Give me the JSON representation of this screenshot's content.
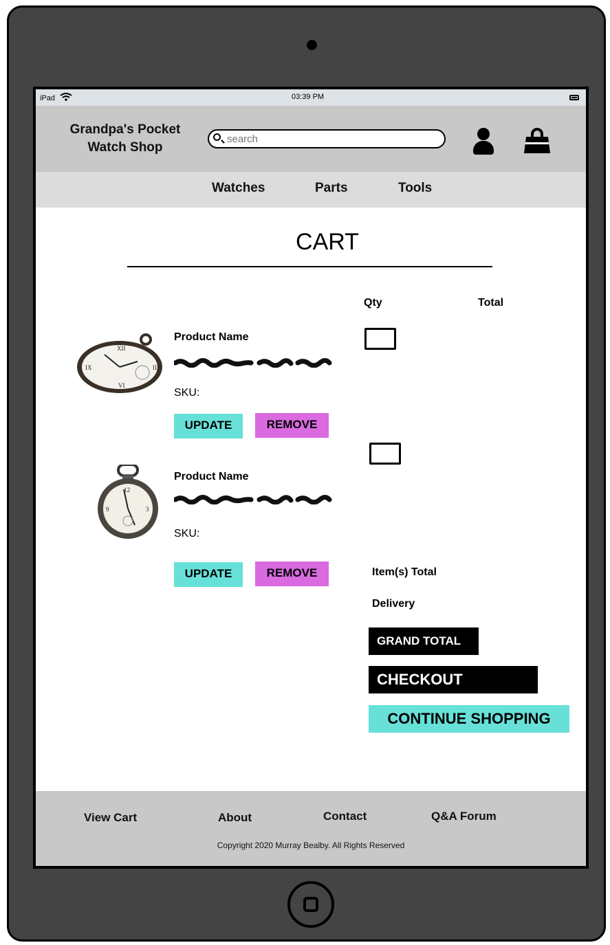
{
  "status_bar": {
    "device": "iPad",
    "time": "03:39 PM"
  },
  "header": {
    "logo_line1": "Grandpa's Pocket",
    "logo_line2": "Watch Shop",
    "search_placeholder": "search",
    "icons": [
      "search-icon",
      "user-icon",
      "shopping-bag-icon"
    ]
  },
  "nav": {
    "items": [
      "Watches",
      "Parts",
      "Tools"
    ]
  },
  "cart": {
    "title": "CART",
    "columns": {
      "qty": "Qty",
      "total": "Total"
    },
    "items": [
      {
        "name": "Product Name",
        "sku_label": "SKU:",
        "update_label": "UPDATE",
        "remove_label": "REMOVE"
      },
      {
        "name": "Product Name",
        "sku_label": "SKU:",
        "update_label": "UPDATE",
        "remove_label": "REMOVE"
      }
    ],
    "summary": {
      "items_total": "Item(s) Total",
      "delivery": "Delivery",
      "grand_total": "GRAND TOTAL",
      "checkout": "CHECKOUT",
      "continue_shopping": "CONTINUE SHOPPING"
    }
  },
  "footer": {
    "links": [
      "View Cart",
      "About",
      "Contact",
      "Q&A Forum"
    ],
    "copyright": "Copyright  2020 Murray Bealby. All Rights Reserved"
  },
  "colors": {
    "accent_teal": "#67e0d8",
    "accent_magenta": "#d96ae0",
    "frame": "#444444",
    "header_bg": "#c8c8c8"
  }
}
